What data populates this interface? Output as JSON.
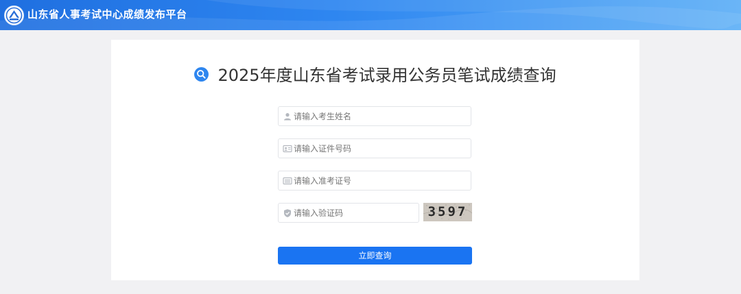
{
  "header": {
    "site_title": "山东省人事考试中心成绩发布平台",
    "logo_icon": "emblem-icon",
    "colors": {
      "gradient_start": "#1f6fe0",
      "gradient_end": "#5fb0f7"
    }
  },
  "main": {
    "title": "2025年度山东省考试录用公务员笔试成绩查询",
    "title_icon": "search-icon",
    "form": {
      "name": {
        "placeholder": "请输入考生姓名",
        "value": "",
        "icon": "user-icon"
      },
      "id_number": {
        "placeholder": "请输入证件号码",
        "value": "",
        "icon": "id-card-icon"
      },
      "ticket_number": {
        "placeholder": "请输入准考证号",
        "value": "",
        "icon": "ticket-icon"
      },
      "captcha": {
        "placeholder": "请输入验证码",
        "value": "",
        "icon": "shield-icon",
        "image_text": "3597"
      },
      "submit_label": "立即查询"
    },
    "colors": {
      "accent": "#1a74f2",
      "background": "#f1f1f3",
      "card": "#ffffff"
    }
  }
}
